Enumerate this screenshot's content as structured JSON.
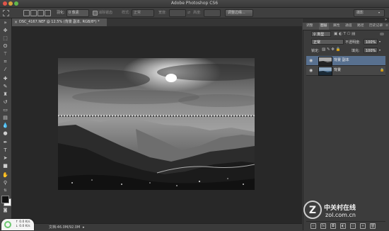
{
  "app": {
    "title": "Adobe Photoshop CS6",
    "window_buttons": [
      {
        "name": "close",
        "color": "#e0554a"
      },
      {
        "name": "minimize",
        "color": "#d8a23a"
      },
      {
        "name": "zoom",
        "color": "#62b84b"
      }
    ]
  },
  "options_bar": {
    "feather_label": "羽化:",
    "feather_value": "0 像素",
    "antialias_label": "消除锯齿",
    "style_label": "样式:",
    "style_value": "正常",
    "width_label": "宽度:",
    "height_label": "高度:",
    "refine_edge_button": "调整边缘...",
    "workspace_select": "摄影"
  },
  "document": {
    "tab_title": "DSC_4167.NEF @ 12.5% (背景 副本, RGB/8*) *",
    "status": "文档:46.0M/92.0M"
  },
  "panels": {
    "tabs": [
      "调整",
      "图层",
      "属性",
      "通道",
      "路径",
      "历史记录"
    ],
    "active_tab_index": 1,
    "filter_kind": "类型",
    "blend_mode": "正常",
    "opacity_label": "不透明度:",
    "opacity_value": "100%",
    "lock_label": "锁定:",
    "fill_label": "填充:",
    "fill_value": "100%",
    "layers": [
      {
        "name": "背景 副本",
        "selected": true
      },
      {
        "name": "背景",
        "selected": false
      }
    ]
  },
  "network_widget": {
    "up": "0.0 K/s",
    "down": "0.0 K/s"
  },
  "watermark": {
    "brand": "中关村在线",
    "domain": "zol.com.cn",
    "letter": "Z"
  },
  "colors": {
    "selected_layer": "#58708f",
    "accent_green": "#6cc870"
  }
}
